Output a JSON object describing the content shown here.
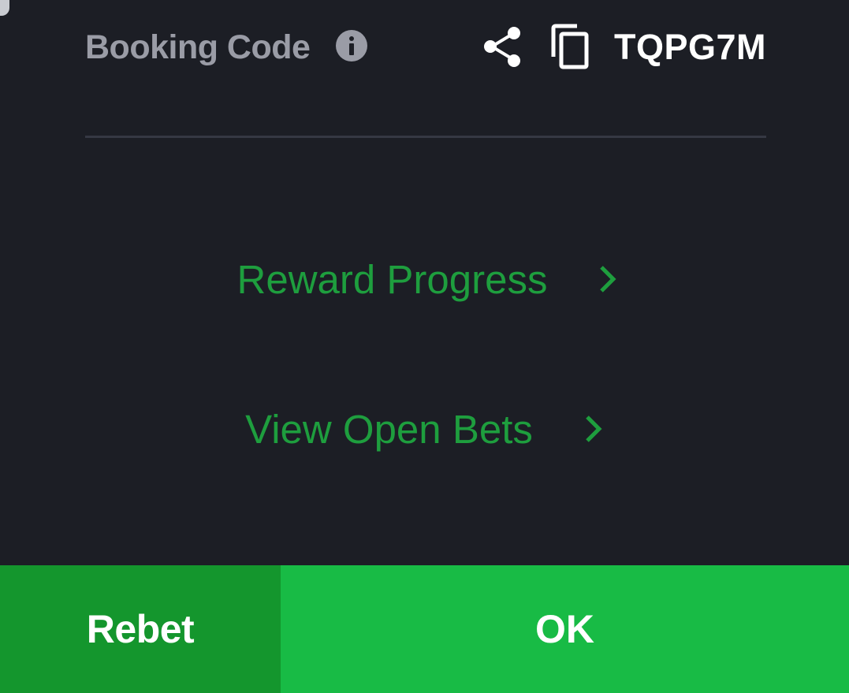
{
  "header": {
    "booking_label": "Booking Code",
    "booking_code": "TQPG7M",
    "icons": {
      "info": "info-icon",
      "share": "share-icon",
      "copy": "copy-icon"
    }
  },
  "links": {
    "reward_progress": "Reward Progress",
    "view_open_bets": "View Open Bets"
  },
  "actions": {
    "rebet_label": "Rebet",
    "ok_label": "OK"
  },
  "colors": {
    "background": "#1c1e25",
    "link_green": "#1e9e3e",
    "rebet_bg": "#14962d",
    "ok_bg": "#18bb45",
    "label_gray": "#9a9ca6",
    "divider": "#353843"
  }
}
